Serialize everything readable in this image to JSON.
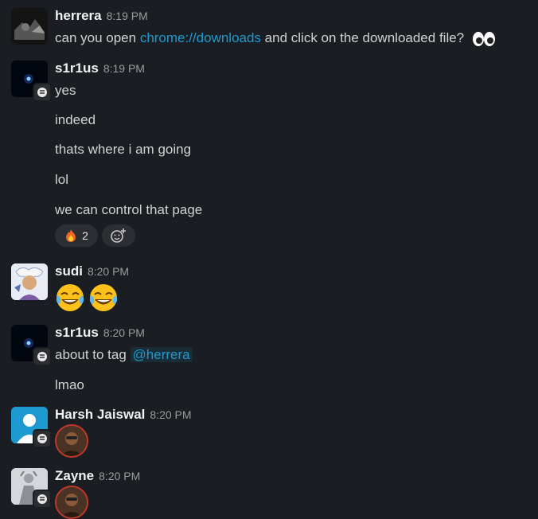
{
  "messages": [
    {
      "user": "herrera",
      "time": "8:19 PM",
      "text_before": "can you open ",
      "link": "chrome://downloads",
      "text_after": " and click on the downloaded file?",
      "emoji": "eyes"
    },
    {
      "user": "s1r1us",
      "time": "8:19 PM",
      "lines": [
        "yes",
        "indeed",
        "thats where i am going",
        "lol",
        "we can control that page"
      ],
      "reactions": [
        {
          "emoji": "fire",
          "count": "2"
        }
      ]
    },
    {
      "user": "sudi",
      "time": "8:20 PM",
      "emoji": "face-with-tears-of-joy x2"
    },
    {
      "user": "s1r1us",
      "time": "8:20 PM",
      "text_before": "about to tag ",
      "mention": "@herrera",
      "lines": [
        "lmao"
      ]
    },
    {
      "user": "Harsh Jaiswal",
      "time": "8:20 PM"
    },
    {
      "user": "Zayne",
      "time": "8:20 PM"
    }
  ],
  "colors": {
    "background": "#1a1d21",
    "link": "#1d9bd1",
    "text": "#d1d2d3",
    "name": "#f0f1f2",
    "timestamp": "#9a9b9e"
  }
}
